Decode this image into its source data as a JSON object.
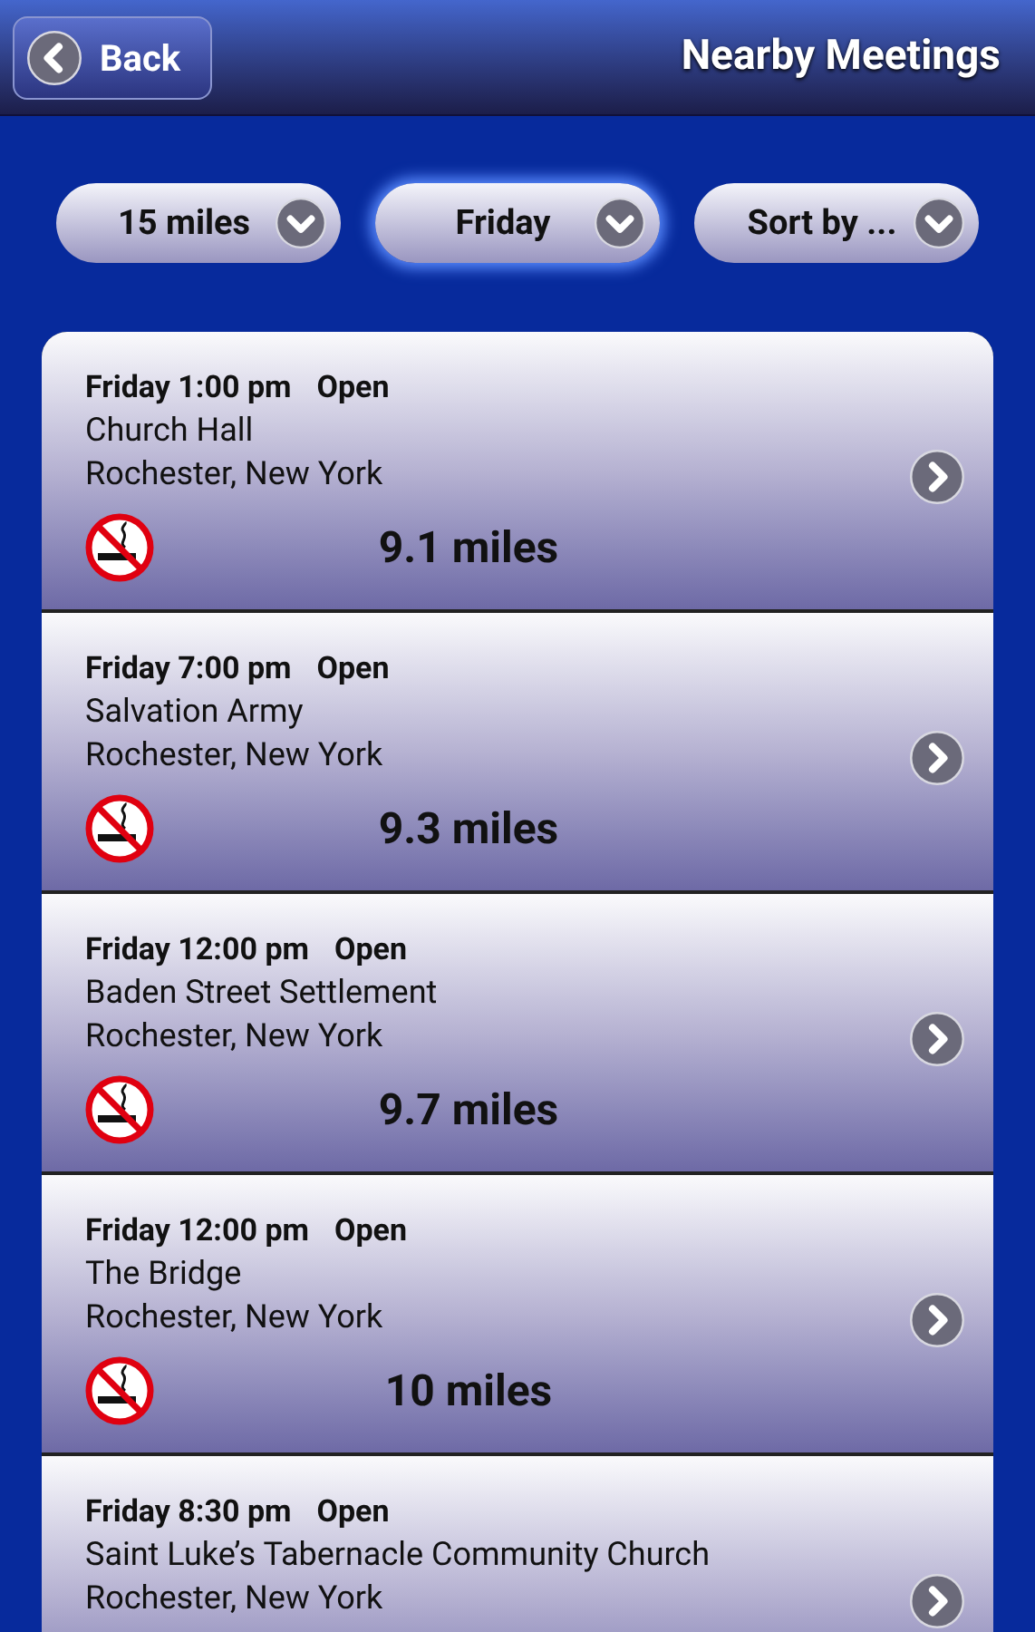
{
  "header": {
    "back": "Back",
    "title": "Nearby Meetings"
  },
  "filters": [
    {
      "label": "15 miles",
      "selected": false
    },
    {
      "label": "Friday",
      "selected": true
    },
    {
      "label": "Sort by ...",
      "selected": false
    }
  ],
  "meetings": [
    {
      "when": "Friday 1:00 pm",
      "type": "Open",
      "name": "Church Hall",
      "location": "Rochester, New York",
      "no_smoking": true,
      "distance": "9.1 miles"
    },
    {
      "when": "Friday 7:00 pm",
      "type": "Open",
      "name": "Salvation Army",
      "location": "Rochester, New York",
      "no_smoking": true,
      "distance": "9.3 miles"
    },
    {
      "when": "Friday 12:00 pm",
      "type": "Open",
      "name": "Baden Street Settlement",
      "location": "Rochester, New York",
      "no_smoking": true,
      "distance": "9.7 miles"
    },
    {
      "when": "Friday 12:00 pm",
      "type": "Open",
      "name": "The Bridge",
      "location": "Rochester, New York",
      "no_smoking": true,
      "distance": "10 miles"
    },
    {
      "when": "Friday 8:30 pm",
      "type": "Open",
      "name": "Saint Luke’s Tabernacle Community Church",
      "location": "Rochester, New York"
    }
  ]
}
